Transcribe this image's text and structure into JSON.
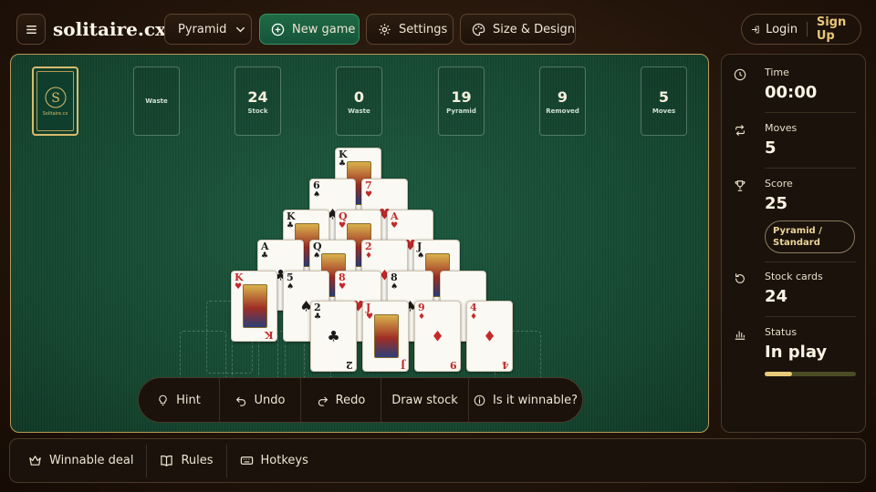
{
  "header": {
    "logo": "solitaire.cx",
    "variant": "Pyramid",
    "new_game": "New game",
    "settings": "Settings",
    "design": "Size & Design",
    "login": "Login",
    "signup": "Sign Up"
  },
  "board": {
    "waste_slot": "Waste",
    "counters": [
      {
        "value": "24",
        "label": "Stock"
      },
      {
        "value": "0",
        "label": "Waste"
      },
      {
        "value": "19",
        "label": "Pyramid"
      },
      {
        "value": "9",
        "label": "Removed"
      },
      {
        "value": "5",
        "label": "Moves"
      }
    ],
    "stock_brand": "Solitaire.cx",
    "stock_monogram": "S",
    "cards": [
      {
        "id": "c1",
        "rank": "K",
        "suit": "♣",
        "color": "black"
      },
      {
        "id": "c2",
        "rank": "6",
        "suit": "♠",
        "color": "black"
      },
      {
        "id": "c3",
        "rank": "7",
        "suit": "♥",
        "color": "red"
      },
      {
        "id": "c4",
        "rank": "K",
        "suit": "♣",
        "color": "black"
      },
      {
        "id": "c5",
        "rank": "Q",
        "suit": "♥",
        "color": "red"
      },
      {
        "id": "c6",
        "rank": "A",
        "suit": "♥",
        "color": "red"
      },
      {
        "id": "c7",
        "rank": "A",
        "suit": "♣",
        "color": "black"
      },
      {
        "id": "c8",
        "rank": "Q",
        "suit": "♠",
        "color": "black"
      },
      {
        "id": "c9",
        "rank": "2",
        "suit": "♦",
        "color": "red"
      },
      {
        "id": "c10",
        "rank": "J",
        "suit": "♠",
        "color": "black"
      },
      {
        "id": "c11",
        "rank": "K",
        "suit": "♥",
        "color": "red"
      },
      {
        "id": "c12",
        "rank": "5",
        "suit": "♠",
        "color": "black"
      },
      {
        "id": "c13",
        "rank": "8",
        "suit": "♥",
        "color": "red"
      },
      {
        "id": "c14",
        "rank": "8",
        "suit": "♠",
        "color": "black"
      },
      {
        "id": "c15",
        "rank": "",
        "suit": "",
        "color": "red"
      },
      {
        "id": "c16",
        "rank": "2",
        "suit": "♣",
        "color": "black"
      },
      {
        "id": "c17",
        "rank": "J",
        "suit": "♥",
        "color": "red"
      },
      {
        "id": "c18",
        "rank": "9",
        "suit": "♦",
        "color": "red"
      },
      {
        "id": "c19",
        "rank": "4",
        "suit": "♦",
        "color": "red"
      }
    ]
  },
  "actions": {
    "hint": "Hint",
    "undo": "Undo",
    "redo": "Redo",
    "draw": "Draw stock",
    "winnable": "Is it winnable?"
  },
  "sidebar": {
    "time_label": "Time",
    "time_value": "00:00",
    "moves_label": "Moves",
    "moves_value": "5",
    "score_label": "Score",
    "score_value": "25",
    "mode_badge": "Pyramid / Standard",
    "stock_label": "Stock cards",
    "stock_value": "24",
    "status_label": "Status",
    "status_value": "In play",
    "progress_fraction": 0.3
  },
  "footer": {
    "winnable_deal": "Winnable deal",
    "rules": "Rules",
    "hotkeys": "Hotkeys"
  },
  "colors": {
    "accent": "#1f6a44",
    "gold": "#e9c97a",
    "felt": "#14452f"
  }
}
